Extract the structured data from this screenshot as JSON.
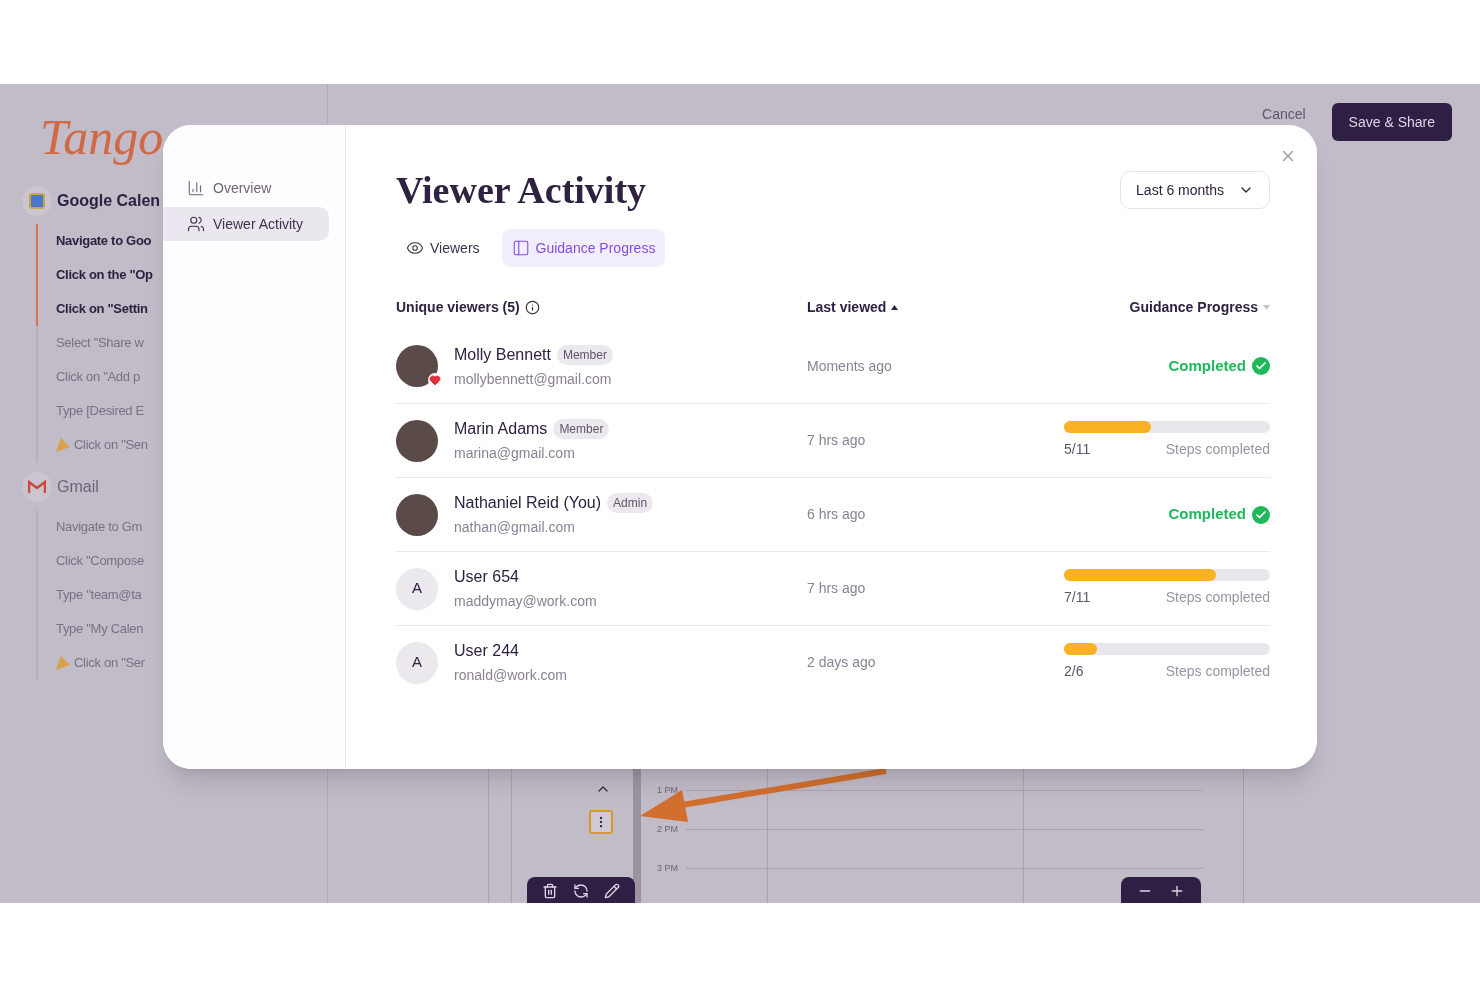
{
  "app": {
    "logo": "Tango",
    "cancel": "Cancel",
    "save": "Save & Share"
  },
  "guide": [
    {
      "app": "Google Calen",
      "active": true,
      "steps": [
        {
          "text": "Navigate to Goo",
          "kind": "step",
          "done": true
        },
        {
          "text": "Click on the \"Op",
          "kind": "step",
          "done": true
        },
        {
          "text": "Click on \"Settin",
          "kind": "step",
          "done": true
        },
        {
          "text": "Select \"Share w",
          "kind": "step",
          "done": false
        },
        {
          "text": "Click on \"Add p",
          "kind": "step",
          "done": false
        },
        {
          "text": "Type [Desired E",
          "kind": "step",
          "done": false
        },
        {
          "text": "Click on \"Sen",
          "kind": "final",
          "done": false
        }
      ]
    },
    {
      "app": "Gmail",
      "active": false,
      "steps": [
        {
          "text": "Navigate to Gm",
          "kind": "step",
          "done": false
        },
        {
          "text": "Click \"Compose",
          "kind": "step",
          "done": false
        },
        {
          "text": "Type \"team@ta",
          "kind": "step",
          "done": false
        },
        {
          "text": "Type \"My Calen",
          "kind": "step",
          "done": false
        },
        {
          "text": "Click on \"Ser",
          "kind": "final",
          "done": false
        }
      ]
    }
  ],
  "calendar": {
    "times": [
      "1 PM",
      "2 PM",
      "3 PM"
    ]
  },
  "modal": {
    "nav": [
      {
        "label": "Overview",
        "selected": false
      },
      {
        "label": "Viewer Activity",
        "selected": true
      }
    ],
    "title": "Viewer Activity",
    "range": "Last 6 months",
    "tabs": [
      {
        "label": "Viewers",
        "selected": false
      },
      {
        "label": "Guidance Progress",
        "selected": true
      }
    ],
    "columns": [
      {
        "label": "Unique viewers (5)",
        "info": true,
        "sortable": false,
        "sorted": false
      },
      {
        "label": "Last viewed",
        "info": false,
        "sortable": true,
        "sorted": true
      },
      {
        "label": "Guidance Progress",
        "info": false,
        "sortable": true,
        "sorted": false
      }
    ],
    "rows": [
      {
        "name": "Molly Bennett",
        "role": "Member",
        "email": "mollybennett@gmail.com",
        "photo": true,
        "liked": true,
        "last_viewed": "Moments ago",
        "completed": true,
        "completed_label": "Completed"
      },
      {
        "name": "Marin Adams",
        "role": "Member",
        "email": "marina@gmail.com",
        "photo": true,
        "liked": false,
        "last_viewed": "7 hrs ago",
        "completed": false,
        "level": 0.42,
        "steps": "5/11",
        "steps_label": "Steps completed"
      },
      {
        "name": "Nathaniel Reid (You)",
        "role": "Admin",
        "email": "nathan@gmail.com",
        "photo": true,
        "liked": false,
        "last_viewed": "6 hrs ago",
        "completed": true,
        "completed_label": "Completed"
      },
      {
        "name": "User 654",
        "email": "maddymay@work.com",
        "photo": false,
        "initial": "A",
        "liked": false,
        "last_viewed": "7 hrs ago",
        "completed": false,
        "level": 0.74,
        "steps": "7/11",
        "steps_label": "Steps completed"
      },
      {
        "name": "User 244",
        "email": "ronald@work.com",
        "photo": false,
        "initial": "A",
        "liked": false,
        "last_viewed": "2 days ago",
        "completed": false,
        "level": 0.16,
        "steps": "2/6",
        "steps_label": "Steps completed"
      }
    ]
  }
}
